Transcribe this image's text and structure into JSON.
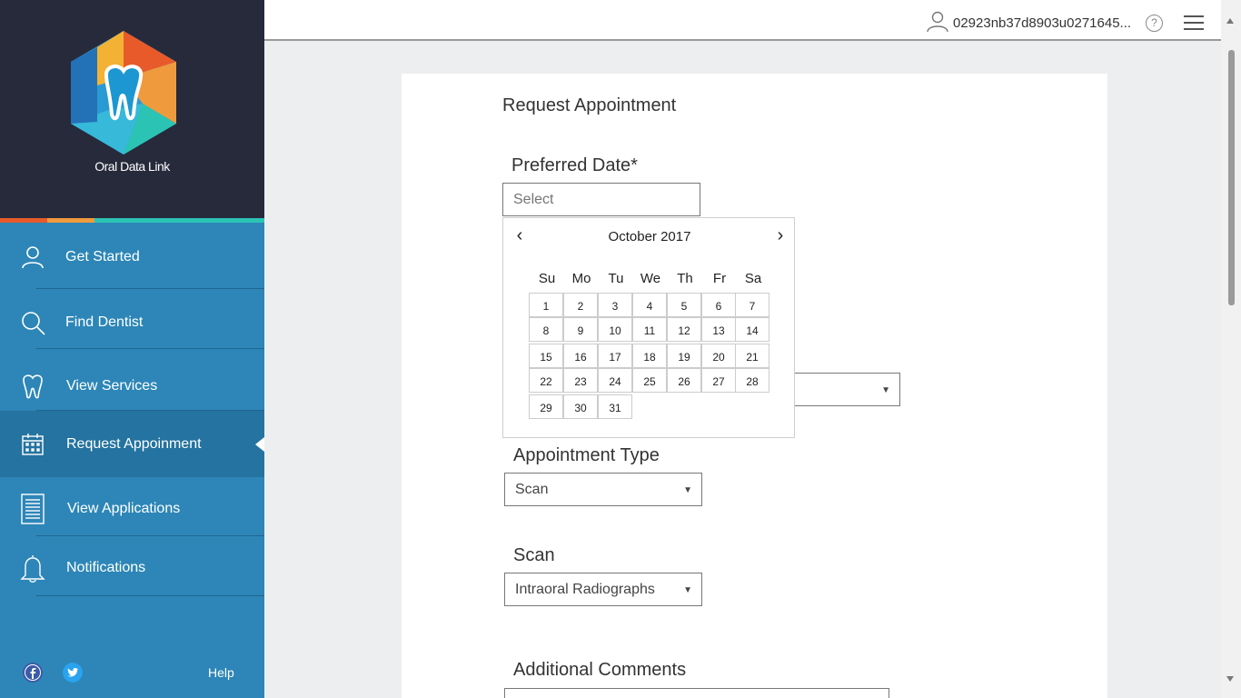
{
  "brand": {
    "name": "Oral Data Link"
  },
  "sidebar": {
    "items": [
      {
        "label": "Get Started",
        "icon": "user-icon"
      },
      {
        "label": "Find Dentist",
        "icon": "search-icon"
      },
      {
        "label": "View Services",
        "icon": "tooth-icon"
      },
      {
        "label": "Request Appoinment",
        "icon": "calendar-icon"
      },
      {
        "label": "View Applications",
        "icon": "document-list-icon"
      },
      {
        "label": "Notifications",
        "icon": "bell-icon"
      }
    ],
    "help": "Help"
  },
  "topbar": {
    "user_id": "02923nb37d8903u0271645..."
  },
  "form": {
    "title": "Request Appointment",
    "preferred_date": {
      "label": "Preferred Date*",
      "placeholder": "Select"
    },
    "appointment_type": {
      "label": "Appointment Type",
      "value": "Scan"
    },
    "scan": {
      "label": "Scan",
      "value": "Intraoral Radiographs"
    },
    "comments": {
      "label": "Additional Comments"
    }
  },
  "calendar": {
    "month_label": "October 2017",
    "weekdays": [
      "Su",
      "Mo",
      "Tu",
      "We",
      "Th",
      "Fr",
      "Sa"
    ],
    "days": [
      1,
      2,
      3,
      4,
      5,
      6,
      7,
      8,
      9,
      10,
      11,
      12,
      13,
      14,
      15,
      16,
      17,
      18,
      19,
      20,
      21,
      22,
      23,
      24,
      25,
      26,
      27,
      28,
      29,
      30,
      31
    ]
  },
  "colors": {
    "sidebar_bg": "#2d86b7",
    "brand_bg": "#272a3b",
    "active_item_bg": "#2473a0"
  }
}
